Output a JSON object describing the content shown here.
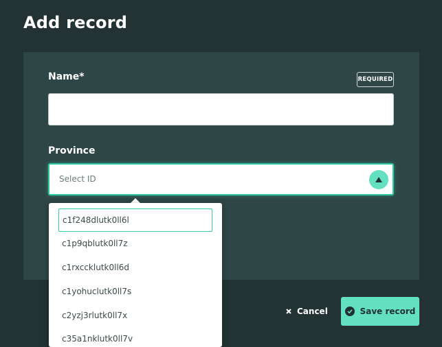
{
  "page": {
    "title": "Add record"
  },
  "form": {
    "name": {
      "label": "Name*",
      "badge": "REQUIRED",
      "value": ""
    },
    "province": {
      "label": "Province",
      "placeholder": "Select ID",
      "dropdown": {
        "search_value": "c1f248dlutk0ll6l",
        "options": [
          "c1p9qblutk0ll7z",
          "c1rxccklutk0ll6d",
          "c1yohuclutk0ll7s",
          "c2yzj3rlutk0ll7x",
          "c35a1nklutk0ll7v"
        ]
      }
    }
  },
  "actions": {
    "cancel_label": "Cancel",
    "save_label": "Save record"
  },
  "colors": {
    "background": "#233232",
    "panel": "#2f4646",
    "accent": "#63e0c2",
    "focus": "#2fc9a3"
  }
}
